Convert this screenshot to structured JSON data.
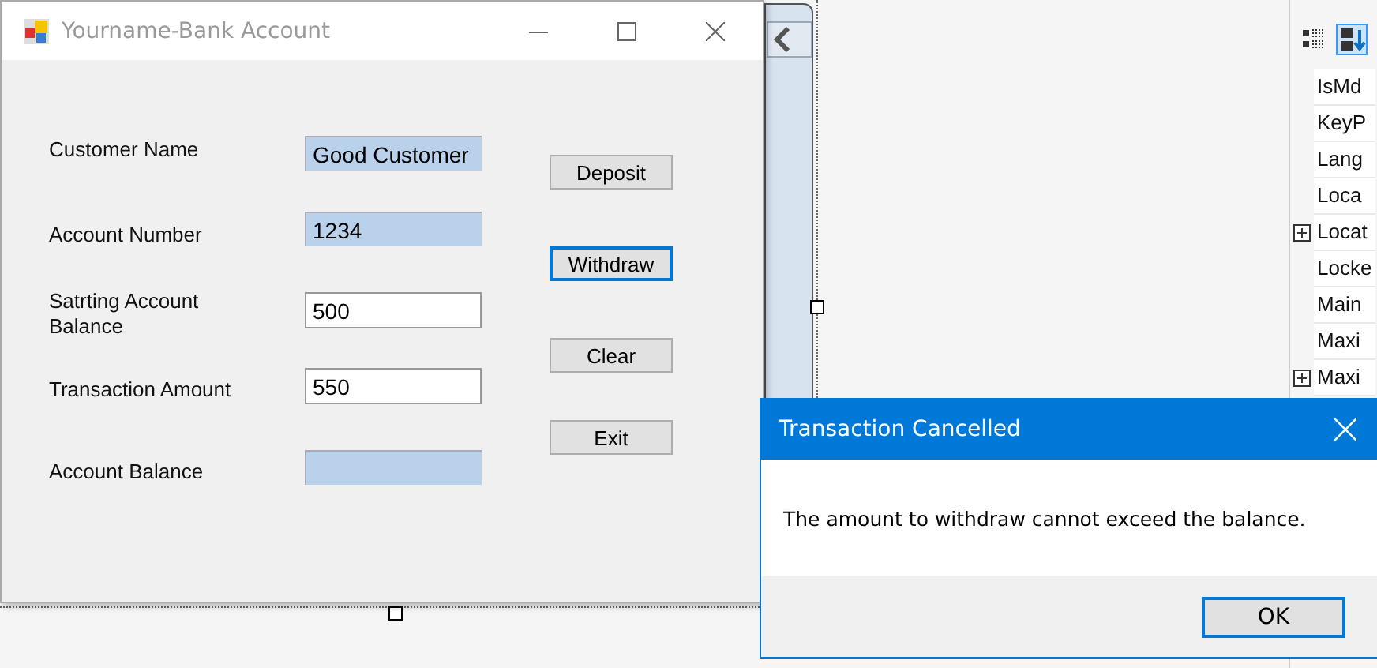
{
  "form_window": {
    "title": "Yourname-Bank Account",
    "fields": [
      {
        "label": "Customer Name",
        "value": "Good Customer",
        "read_only": true
      },
      {
        "label": "Account Number",
        "value": "1234",
        "read_only": true
      },
      {
        "label": "Satrting Account Balance",
        "value": "500",
        "read_only": false
      },
      {
        "label": "Transaction Amount",
        "value": "550",
        "read_only": false
      },
      {
        "label": "Account Balance",
        "read_only": true
      }
    ],
    "buttons": [
      {
        "label": "Deposit",
        "focused": false
      },
      {
        "label": "Withdraw",
        "focused": true
      },
      {
        "label": "Clear",
        "focused": false
      },
      {
        "label": "Exit",
        "focused": false
      }
    ]
  },
  "properties_panel": {
    "items": [
      {
        "name": "IsMd",
        "expandable": false
      },
      {
        "name": "KeyP",
        "expandable": false
      },
      {
        "name": "Lang",
        "expandable": false
      },
      {
        "name": "Loca",
        "expandable": false
      },
      {
        "name": "Locat",
        "expandable": true
      },
      {
        "name": "Locke",
        "expandable": false
      },
      {
        "name": "Main",
        "expandable": false
      },
      {
        "name": "Maxi",
        "expandable": false
      },
      {
        "name": "Maxi",
        "expandable": true
      }
    ]
  },
  "dialog": {
    "title": "Transaction Cancelled",
    "message": "The amount to withdraw cannot exceed the balance.",
    "buttons": [
      {
        "label": "OK",
        "focused": true
      }
    ]
  }
}
